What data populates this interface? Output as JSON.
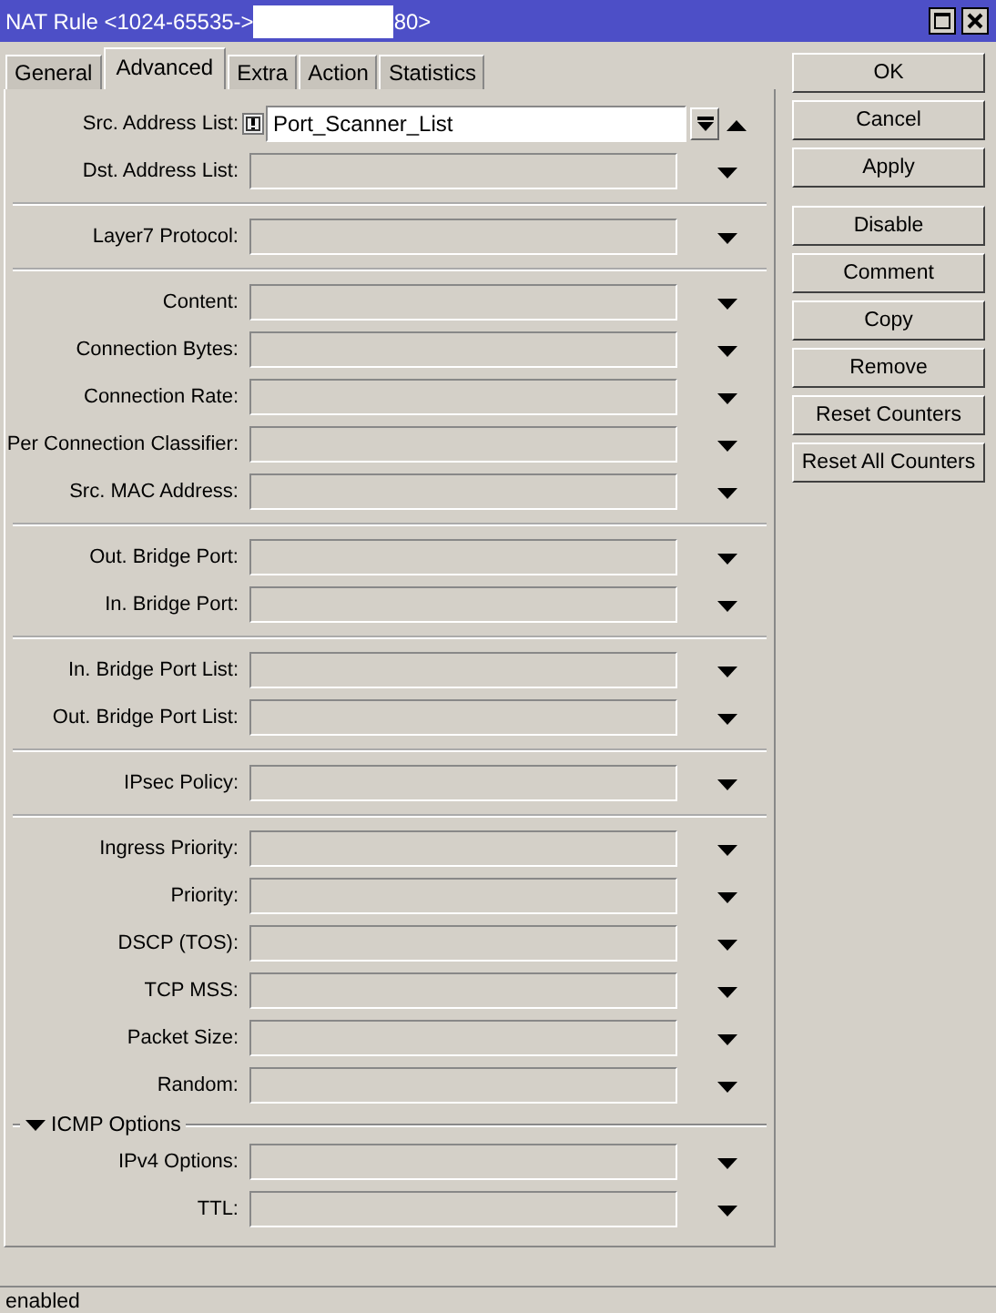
{
  "window": {
    "title_start": "NAT Rule <1024-65535->",
    "title_end": "80>"
  },
  "tabs": [
    {
      "label": "General",
      "selected": false
    },
    {
      "label": "Advanced",
      "selected": true
    },
    {
      "label": "Extra",
      "selected": false
    },
    {
      "label": "Action",
      "selected": false
    },
    {
      "label": "Statistics",
      "selected": false
    }
  ],
  "groups": [
    {
      "fields": [
        {
          "label": "Src. Address List:",
          "value": "Port_Scanner_List",
          "negate": true,
          "expanded": true
        },
        {
          "label": "Dst. Address List:",
          "negate": false,
          "expanded": false
        }
      ]
    },
    {
      "fields": [
        {
          "label": "Layer7 Protocol:",
          "negate": false,
          "expanded": false
        }
      ]
    },
    {
      "fields": [
        {
          "label": "Content:",
          "negate": false,
          "expanded": false
        },
        {
          "label": "Connection Bytes:",
          "negate": false,
          "expanded": false
        },
        {
          "label": "Connection Rate:",
          "negate": false,
          "expanded": false
        },
        {
          "label": "Per Connection Classifier:",
          "negate": false,
          "expanded": false
        },
        {
          "label": "Src. MAC Address:",
          "negate": false,
          "expanded": false
        }
      ]
    },
    {
      "fields": [
        {
          "label": "Out. Bridge Port:",
          "negate": false,
          "expanded": false
        },
        {
          "label": "In. Bridge Port:",
          "negate": false,
          "expanded": false
        }
      ]
    },
    {
      "fields": [
        {
          "label": "In. Bridge Port List:",
          "negate": false,
          "expanded": false
        },
        {
          "label": "Out. Bridge Port List:",
          "negate": false,
          "expanded": false
        }
      ]
    },
    {
      "fields": [
        {
          "label": "IPsec Policy:",
          "negate": false,
          "expanded": false
        }
      ]
    },
    {
      "fields": [
        {
          "label": "Ingress Priority:",
          "negate": false,
          "expanded": false
        },
        {
          "label": "Priority:",
          "negate": false,
          "expanded": false
        },
        {
          "label": "DSCP (TOS):",
          "negate": false,
          "expanded": false
        },
        {
          "label": "TCP MSS:",
          "negate": false,
          "expanded": false
        },
        {
          "label": "Packet Size:",
          "negate": false,
          "expanded": false
        },
        {
          "label": "Random:",
          "negate": false,
          "expanded": false
        }
      ]
    },
    {
      "section": {
        "label": "ICMP Options",
        "expanded": true
      },
      "fields": [
        {
          "label": "IPv4 Options:",
          "negate": false,
          "expanded": false
        },
        {
          "label": "TTL:",
          "negate": false,
          "expanded": false
        }
      ]
    }
  ],
  "buttons": [
    [
      "OK",
      "Cancel",
      "Apply"
    ],
    [
      "Disable",
      "Comment",
      "Copy",
      "Remove",
      "Reset Counters",
      "Reset All Counters"
    ]
  ],
  "status_bar": {
    "text": "enabled"
  }
}
